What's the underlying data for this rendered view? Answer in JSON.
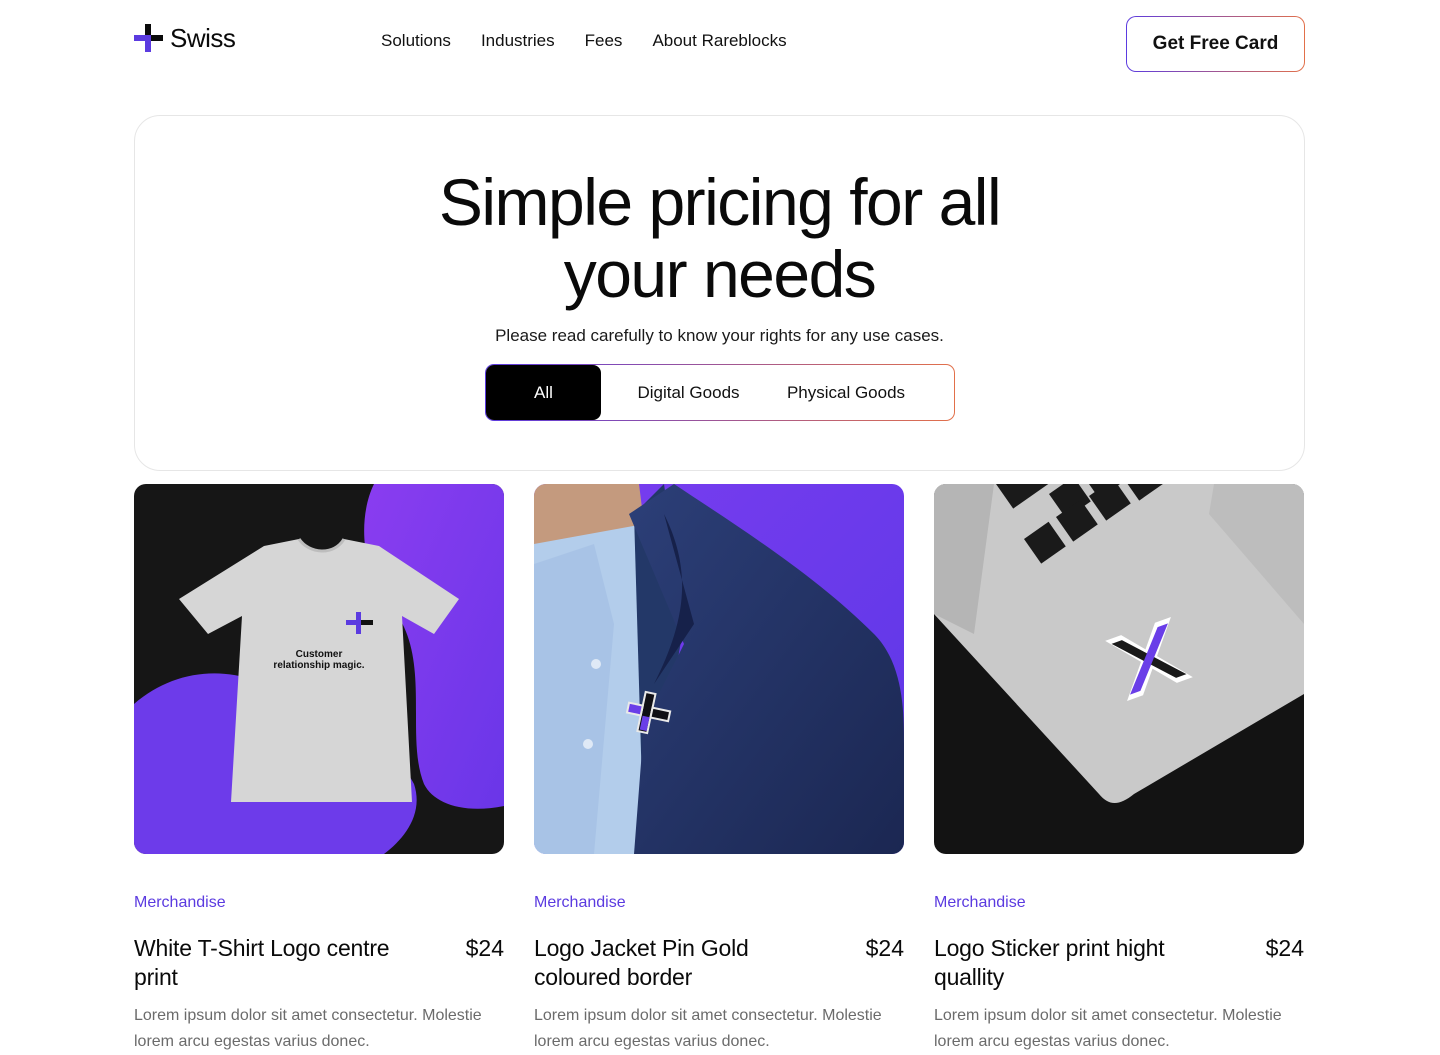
{
  "brand": {
    "name": "Swiss",
    "accent": "#5b3be0",
    "accent_warm": "#e2704a"
  },
  "nav": [
    {
      "label": "Solutions"
    },
    {
      "label": "Industries"
    },
    {
      "label": "Fees"
    },
    {
      "label": "About Rareblocks"
    }
  ],
  "header": {
    "cta_label": "Get Free Card"
  },
  "hero": {
    "title_line1": "Simple pricing for all",
    "title_line2": "your needs",
    "subtitle": "Please read carefully to know your rights for any use cases.",
    "tabs": [
      {
        "label": "All",
        "active": true
      },
      {
        "label": "Digital Goods",
        "active": false
      },
      {
        "label": "Physical Goods",
        "active": false
      }
    ]
  },
  "products": [
    {
      "category": "Merchandise",
      "title": "White T-Shirt Logo centre print",
      "price": "$24",
      "description": "Lorem ipsum dolor sit amet consectetur. Molestie lorem arcu egestas varius donec.",
      "image": "tshirt-mockup",
      "shirt_text": "Customer relationship magic."
    },
    {
      "category": "Merchandise",
      "title": "Logo Jacket Pin Gold coloured border",
      "price": "$24",
      "description": "Lorem ipsum dolor sit amet consectetur. Molestie lorem arcu egestas varius donec.",
      "image": "jacket-pin-photo"
    },
    {
      "category": "Merchandise",
      "title": "Logo Sticker print hight quallity",
      "price": "$24",
      "description": "Lorem ipsum dolor sit amet consectetur. Molestie lorem arcu egestas varius donec.",
      "image": "laptop-sticker-photo"
    }
  ]
}
